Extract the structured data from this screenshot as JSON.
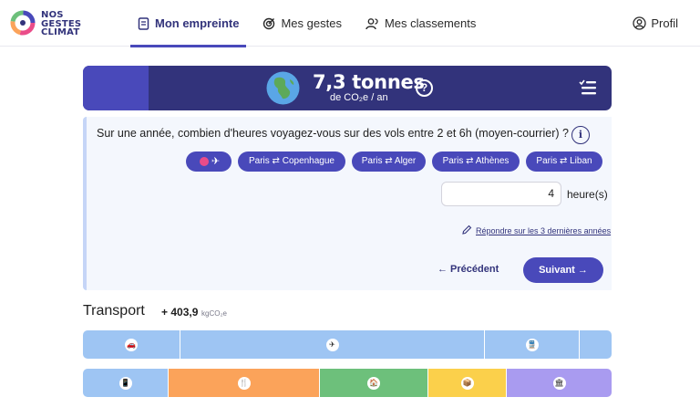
{
  "header": {
    "logo_lines": [
      "NOS",
      "GESTES",
      "CLIMAT"
    ],
    "nav": [
      {
        "label": "Mon empreinte",
        "active": true,
        "icon": "footprint-icon"
      },
      {
        "label": "Mes gestes",
        "active": false,
        "icon": "target-icon"
      },
      {
        "label": "Mes classements",
        "active": false,
        "icon": "group-icon"
      }
    ],
    "profile_label": "Profil"
  },
  "banner": {
    "value": "7,3 tonnes",
    "unit": "de CO₂e / an",
    "help": "?",
    "icons": [
      "globe-icon",
      "help-icon",
      "list-check-icon"
    ]
  },
  "question": {
    "text": "Sur une année, combien d'heures voyagez-vous sur des vols entre 2 et 6h (moyen-courrier) ?",
    "info": "i",
    "chips": [
      "Paris ⇄ Copenhague",
      "Paris ⇄ Alger",
      "Paris ⇄ Athènes",
      "Paris ⇄ Liban"
    ],
    "no_flight_icon": "plane-icon",
    "input_value": "4",
    "unit": "heure(s)",
    "three_years_link": "Répondre sur les 3 dernières années",
    "prev_label": "← Précédent",
    "next_label": "Suivant →"
  },
  "category": {
    "title": "Transport",
    "value": "+ 403,9",
    "unit": "kgCO₂e"
  },
  "colors": {
    "primary": "#4949ba",
    "primary_dark": "#32337b",
    "transport": "#9ec5f3",
    "alimentation": "#fba35a",
    "logement": "#6dc07b",
    "divers": "#fbd04b",
    "services": "#a99bf0"
  }
}
